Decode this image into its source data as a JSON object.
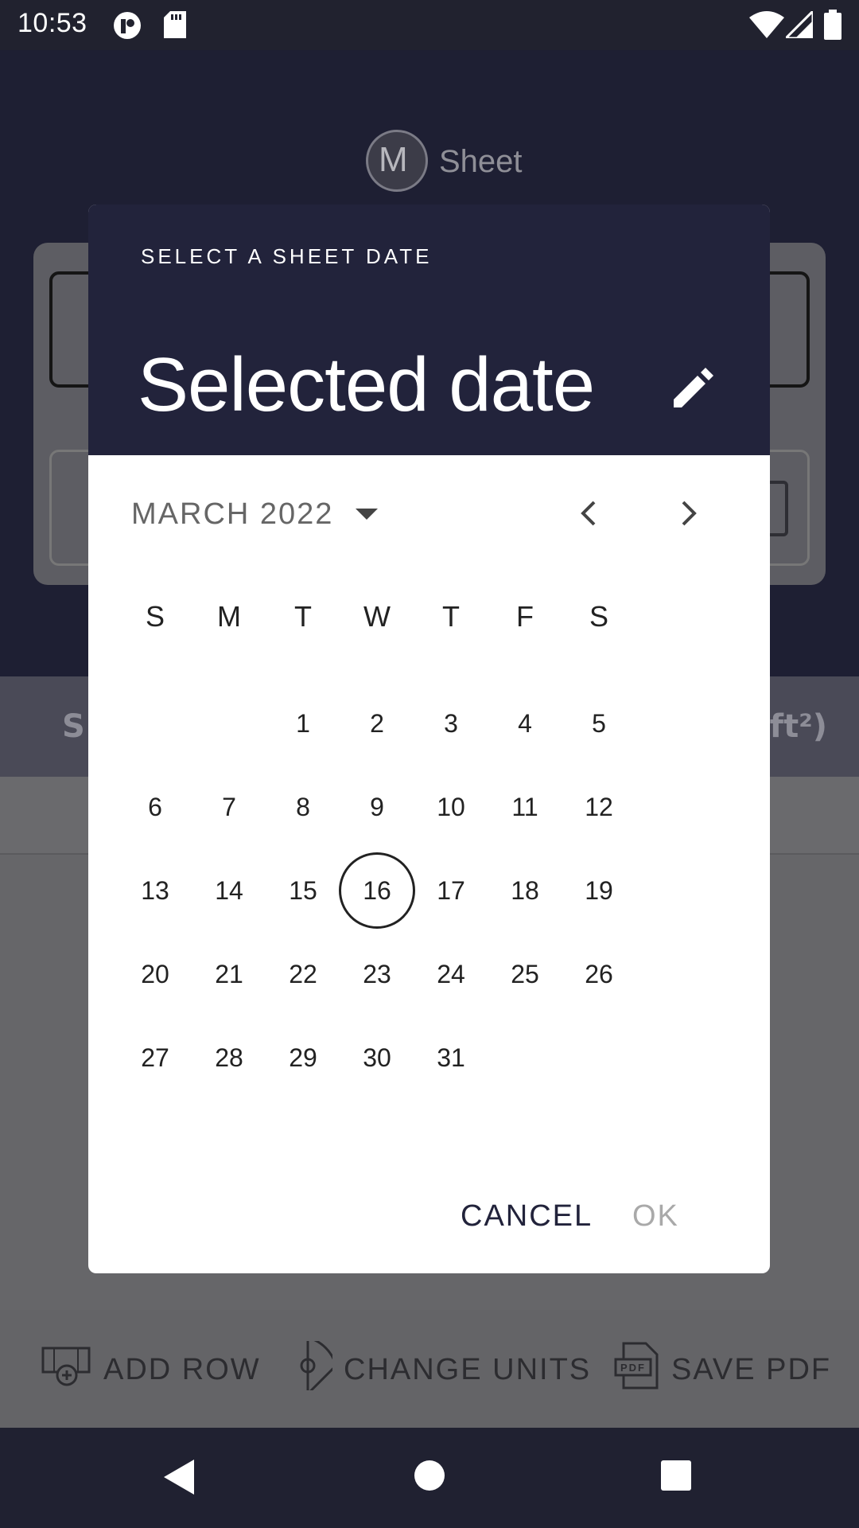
{
  "status_bar": {
    "time": "10:53"
  },
  "app": {
    "logo_letter": "M",
    "logo_text": "Sheet",
    "table_header_left": "S",
    "table_header_right": "(ft²)"
  },
  "toolbar": {
    "add_row": "ADD ROW",
    "change_units": "CHANGE UNITS",
    "save_pdf": "SAVE PDF",
    "pdf_icon_text": "PDF"
  },
  "dialog": {
    "title": "SELECT A SHEET DATE",
    "selected_date": "Selected date",
    "month_label": "MARCH 2022",
    "weekdays": [
      "S",
      "M",
      "T",
      "W",
      "T",
      "F",
      "S"
    ],
    "days": [
      "1",
      "2",
      "3",
      "4",
      "5",
      "6",
      "7",
      "8",
      "9",
      "10",
      "11",
      "12",
      "13",
      "14",
      "15",
      "16",
      "17",
      "18",
      "19",
      "20",
      "21",
      "22",
      "23",
      "24",
      "25",
      "26",
      "27",
      "28",
      "29",
      "30",
      "31"
    ],
    "today": "16",
    "cancel_label": "CANCEL",
    "ok_label": "OK"
  },
  "colors": {
    "header_bg": "#22233b",
    "accent": "#22233b",
    "ok_disabled": "#a9a9a9"
  },
  "icons": [
    "sd-card-icon",
    "wifi-icon",
    "signal-icon",
    "battery-icon",
    "edit-icon",
    "dropdown-icon",
    "chevron-left-icon",
    "chevron-right-icon",
    "back-icon",
    "home-icon",
    "recents-icon"
  ]
}
